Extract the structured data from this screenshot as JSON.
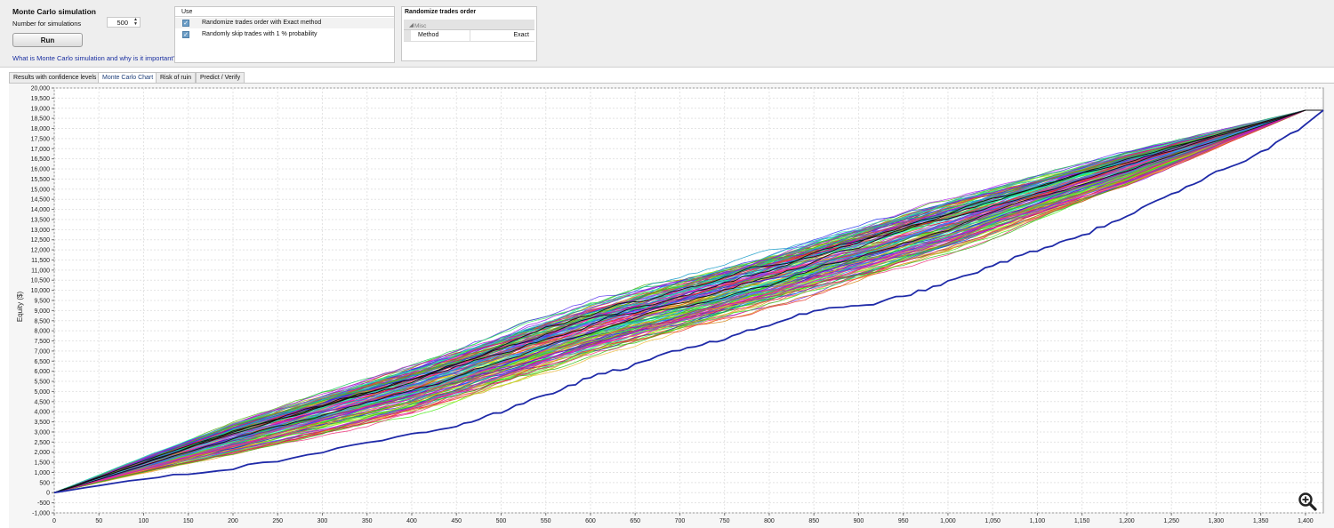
{
  "settings": {
    "title": "Monte Carlo simulation",
    "num_label": "Number for simulations",
    "num_value": "500",
    "run_label": "Run",
    "help_link": "What is Monte Carlo simulation and why is it important?"
  },
  "use_panel": {
    "header": "Use",
    "options": [
      {
        "label": "Randomize trades order with Exact method",
        "checked": true
      },
      {
        "label": "Randomly skip trades with 1 % probability",
        "checked": true
      }
    ]
  },
  "randomize_panel": {
    "title": "Randomize trades order",
    "group": "Misc",
    "property_name": "Method",
    "property_value": "Exact"
  },
  "tabs": [
    {
      "label": "Results with confidence levels",
      "active": false
    },
    {
      "label": "Monte Carlo Chart",
      "active": true
    },
    {
      "label": "Risk of ruin",
      "active": false
    },
    {
      "label": "Predict / Verify",
      "active": false
    }
  ],
  "icons": {
    "zoom": "zoom-in-icon",
    "checkbox": "checkbox-checked-icon",
    "spinner": "spinner-arrows-icon"
  },
  "chart_data": {
    "type": "line",
    "ylabel": "Equity ($)",
    "xlabel": "",
    "xlim": [
      0,
      1420
    ],
    "ylim": [
      -1000,
      20000
    ],
    "x_ticks": [
      "0",
      "50",
      "100",
      "150",
      "200",
      "250",
      "300",
      "350",
      "400",
      "450",
      "500",
      "550",
      "600",
      "650",
      "700",
      "750",
      "800",
      "850",
      "900",
      "950",
      "1,000",
      "1,050",
      "1,100",
      "1,150",
      "1,200",
      "1,250",
      "1,300",
      "1,350",
      "1,400"
    ],
    "y_ticks": [
      "-1,000",
      "-500",
      "0",
      "500",
      "1,000",
      "1,500",
      "2,000",
      "2,500",
      "3,000",
      "3,500",
      "4,000",
      "4,500",
      "5,000",
      "5,500",
      "6,000",
      "6,500",
      "7,000",
      "7,500",
      "8,000",
      "8,500",
      "9,000",
      "9,500",
      "10,000",
      "10,500",
      "11,000",
      "11,500",
      "12,000",
      "12,500",
      "13,000",
      "13,500",
      "14,000",
      "14,500",
      "15,000",
      "15,500",
      "16,000",
      "16,500",
      "17,000",
      "17,500",
      "18,000",
      "18,500",
      "19,000",
      "19,500",
      "20,000"
    ],
    "grid": true,
    "simulation_count": 500,
    "final_equity": 18900,
    "envelope": {
      "x": [
        0,
        200,
        400,
        600,
        800,
        1000,
        1200,
        1400
      ],
      "upper": [
        0,
        3400,
        6200,
        9200,
        11700,
        14400,
        16800,
        18900
      ],
      "lower": [
        0,
        2000,
        4000,
        6900,
        9400,
        12000,
        15200,
        18900
      ]
    },
    "outlier_series": {
      "name": "",
      "color": "#1f2aa8",
      "x": [
        0,
        100,
        200,
        300,
        400,
        450,
        500,
        550,
        600,
        650,
        700,
        750,
        800,
        850,
        900,
        950,
        1000,
        1050,
        1100,
        1150,
        1200,
        1250,
        1300,
        1350,
        1400,
        1420
      ],
      "y": [
        0,
        700,
        1200,
        2000,
        2900,
        3300,
        4000,
        4800,
        5700,
        6300,
        7100,
        7600,
        8300,
        9000,
        9200,
        9700,
        10400,
        11200,
        12000,
        12700,
        13700,
        14700,
        15800,
        16800,
        18200,
        18900
      ]
    }
  }
}
